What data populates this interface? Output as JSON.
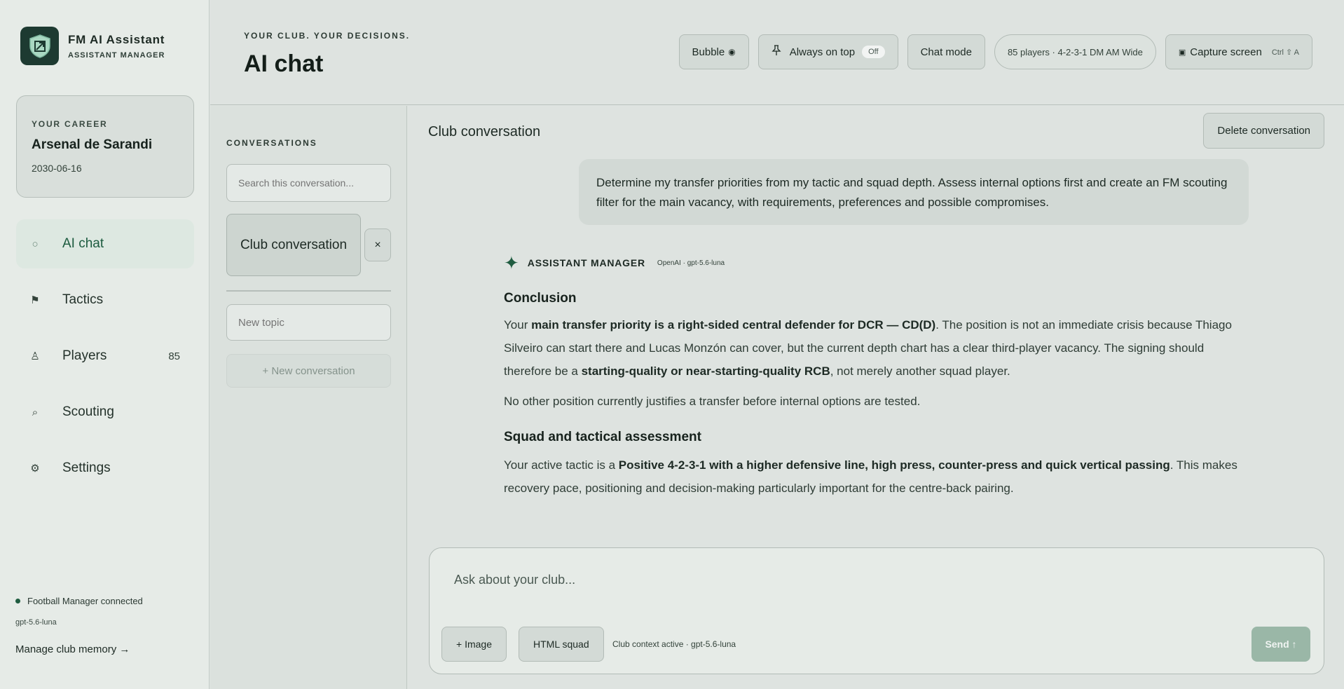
{
  "brand": {
    "title": "FM AI Assistant",
    "subtitle": "ASSISTANT MANAGER",
    "logo_icon": "shield-icon",
    "accent_color": "#1f5c40"
  },
  "career": {
    "label": "YOUR CAREER",
    "club": "Arsenal de Sarandi",
    "date": "2030-06-16"
  },
  "nav": {
    "items": [
      {
        "label": "AI chat",
        "icon": "circle-icon",
        "active": true
      },
      {
        "label": "Tactics",
        "icon": "flag-icon"
      },
      {
        "label": "Players",
        "icon": "player-icon",
        "count": "85"
      },
      {
        "label": "Scouting",
        "icon": "search-icon"
      },
      {
        "label": "Settings",
        "icon": "gear-icon"
      }
    ]
  },
  "status": {
    "connection": "Football Manager connected",
    "model": "gpt-5.6-luna",
    "memory_link": "Manage club memory →"
  },
  "header": {
    "eyebrow": "YOUR CLUB. YOUR DECISIONS.",
    "title": "AI chat"
  },
  "toolbar": {
    "bubble_label": "Bubble",
    "bubble_icon": "◉",
    "always_on_top_label": "Always on top",
    "always_on_top_state": "Off",
    "chat_mode_label": "Chat mode",
    "squad_info": "85 players · 4-2-3-1 DM AM Wide",
    "capture_label": "Capture screen",
    "capture_shortcut": "Ctrl ⇧ A"
  },
  "conversations": {
    "label": "CONVERSATIONS",
    "search_placeholder": "Search this conversation...",
    "items": [
      {
        "title": "Club conversation"
      }
    ],
    "close_label": "×",
    "new_topic_placeholder": "New topic",
    "new_conversation_label": "+ New conversation"
  },
  "chat": {
    "title": "Club conversation",
    "delete_label": "Delete conversation",
    "user_message": "Determine my transfer priorities from my tactic and squad depth. Assess internal options first and create an FM scouting filter for the main vacancy, with requirements, preferences and possible compromises.",
    "assistant": {
      "name": "ASSISTANT MANAGER",
      "model": "OpenAI · gpt-5.6-luna",
      "heading1": "Conclusion",
      "p1_a": "Your ",
      "p1_b": "main transfer priority is a right-sided central defender for DCR — CD(D)",
      "p1_c": ". The position is not an immediate crisis because Thiago Silveiro can start there and Lucas Monzón can cover, but the current depth chart has a clear third-player vacancy. The signing should therefore be a ",
      "p1_d": "starting-quality or near-starting-quality RCB",
      "p1_e": ", not merely another squad player.",
      "p2": "No other position currently justifies a transfer before internal options are tested.",
      "heading2": "Squad and tactical assessment",
      "p3_a": "Your active tactic is a ",
      "p3_b": "Positive 4-2-3-1 with a higher defensive line, high press, counter-press and quick vertical passing",
      "p3_c": ". This makes recovery pace, positioning and decision-making particularly important for the centre-back pairing."
    }
  },
  "composer": {
    "placeholder": "Ask about your club...",
    "image_label": "+ Image",
    "html_squad_label": "HTML squad",
    "context": "Club context active · gpt-5.6-luna",
    "send_label": "Send ↑"
  }
}
